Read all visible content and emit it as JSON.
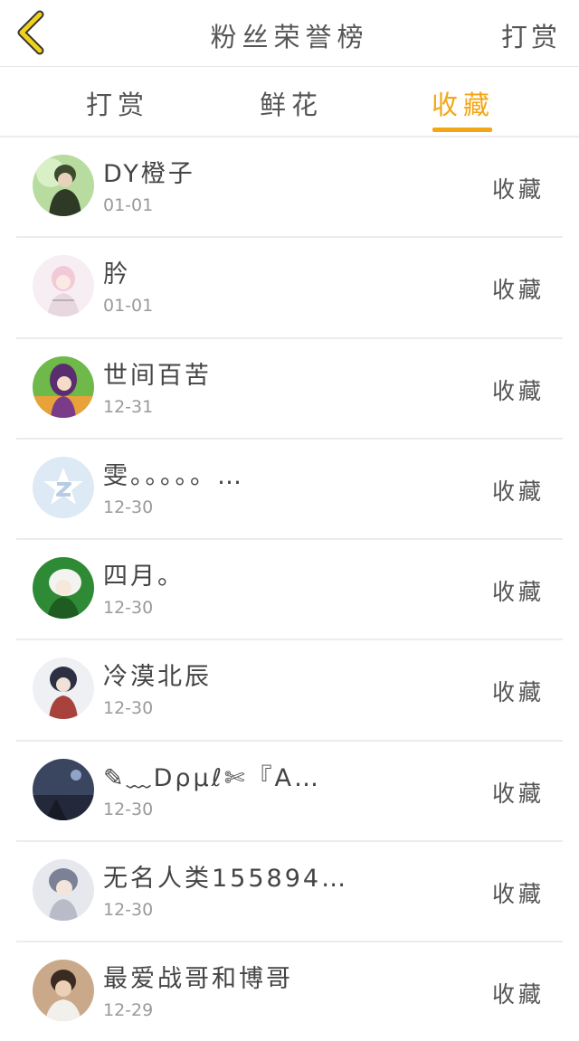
{
  "header": {
    "title": "粉丝荣誉榜",
    "right_action": "打赏"
  },
  "tabs": [
    {
      "label": "打赏",
      "active": false
    },
    {
      "label": "鲜花",
      "active": false
    },
    {
      "label": "收藏",
      "active": true
    }
  ],
  "colors": {
    "accent": "#f3a616",
    "back_icon": "#f0d21a"
  },
  "fans": [
    {
      "name": "DY橙子",
      "date": "01-01",
      "action": "收藏",
      "avatar": "avatar-green-boy"
    },
    {
      "name": "肣",
      "date": "01-01",
      "action": "收藏",
      "avatar": "avatar-pink-sketch"
    },
    {
      "name": "世间百苦",
      "date": "12-31",
      "action": "收藏",
      "avatar": "avatar-purple-girl"
    },
    {
      "name": "雯。。。。。…",
      "date": "12-30",
      "action": "收藏",
      "avatar": "avatar-default-star"
    },
    {
      "name": "四月。",
      "date": "12-30",
      "action": "收藏",
      "avatar": "avatar-white-hair"
    },
    {
      "name": "冷漠北辰",
      "date": "12-30",
      "action": "收藏",
      "avatar": "avatar-dark-hair-scarf"
    },
    {
      "name": "✎﹏Dρμℓ✄『A…",
      "date": "12-30",
      "action": "收藏",
      "avatar": "avatar-night-scene"
    },
    {
      "name": "无名人类155894…",
      "date": "12-30",
      "action": "收藏",
      "avatar": "avatar-gray-hair"
    },
    {
      "name": "最爱战哥和博哥",
      "date": "12-29",
      "action": "收藏",
      "avatar": "avatar-photo"
    }
  ]
}
